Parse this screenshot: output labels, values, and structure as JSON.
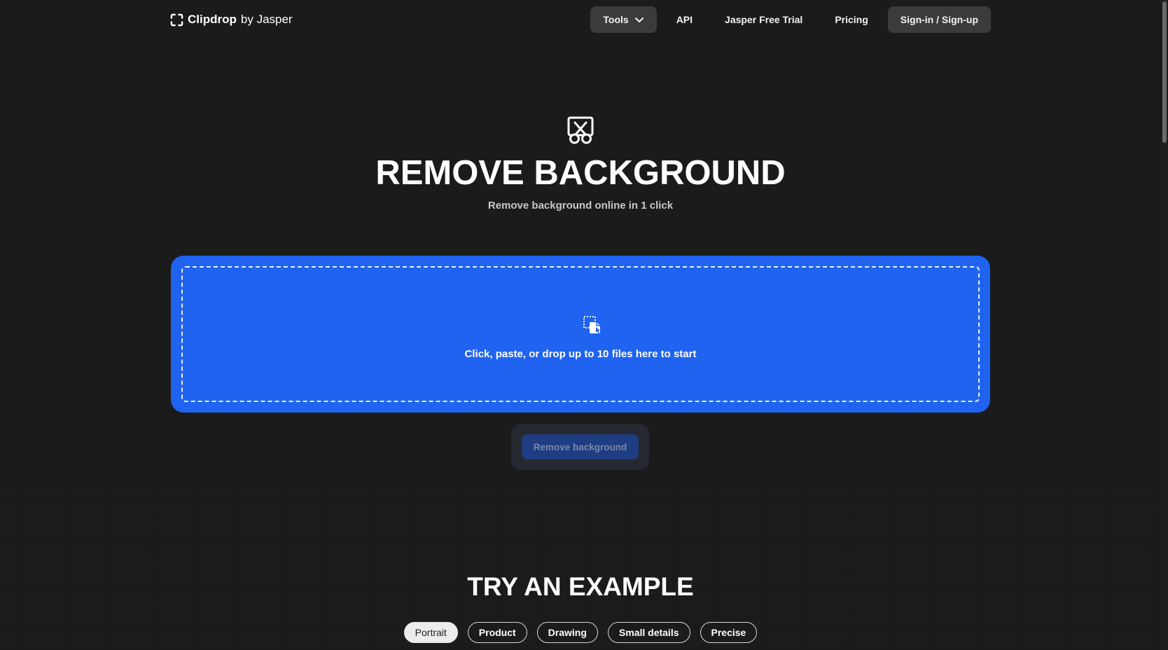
{
  "header": {
    "brand_name": "Clipdrop",
    "brand_by": "by Jasper",
    "nav": {
      "tools": "Tools",
      "api": "API",
      "trial": "Jasper Free Trial",
      "pricing": "Pricing",
      "signin": "Sign-in / Sign-up"
    }
  },
  "hero": {
    "icon": "scissors-icon",
    "title": "REMOVE BACKGROUND",
    "subtitle": "Remove background online in 1 click"
  },
  "dropzone": {
    "icon": "file-drop-icon",
    "text": "Click, paste, or drop up to 10 files here to start",
    "color": "#1f63f0"
  },
  "action": {
    "label": "Remove background",
    "state": "disabled"
  },
  "examples": {
    "title": "TRY AN EXAMPLE",
    "chips": [
      "Portrait",
      "Product",
      "Drawing",
      "Small details",
      "Precise"
    ],
    "selected": "Portrait"
  },
  "colors": {
    "background": "#1b1b1b",
    "accent": "#1f63f0",
    "pill": "#3b3b3b"
  }
}
